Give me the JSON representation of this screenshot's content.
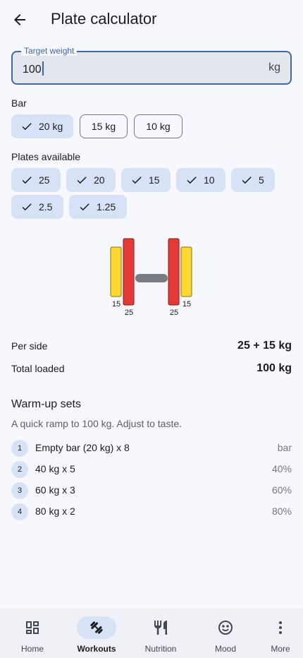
{
  "appbar": {
    "title": "Plate calculator"
  },
  "target": {
    "label": "Target weight",
    "value": "100",
    "suffix": "kg"
  },
  "bar": {
    "label": "Bar",
    "options": [
      {
        "label": "20 kg",
        "selected": true
      },
      {
        "label": "15 kg",
        "selected": false
      },
      {
        "label": "10 kg",
        "selected": false
      }
    ]
  },
  "plates": {
    "label": "Plates available",
    "options": [
      "25",
      "20",
      "15",
      "10",
      "5",
      "2.5",
      "1.25"
    ]
  },
  "visual": {
    "colors": {
      "plate25": "#e53935",
      "plate15": "#fdd835",
      "bar": "#7a7c83"
    },
    "left_outer": "15",
    "left_inner": "25",
    "right_inner": "25",
    "right_outer": "15"
  },
  "summary": {
    "per_side_label": "Per side",
    "per_side_value": "25 + 15 kg",
    "total_label": "Total loaded",
    "total_value": "100 kg"
  },
  "warmup": {
    "title": "Warm-up sets",
    "subtitle": "A quick ramp to 100 kg. Adjust to taste.",
    "items": [
      {
        "num": "1",
        "text": "Empty bar (20 kg) x 8",
        "pct": "bar"
      },
      {
        "num": "2",
        "text": "40 kg x 5",
        "pct": "40%"
      },
      {
        "num": "3",
        "text": "60 kg x 3",
        "pct": "60%"
      },
      {
        "num": "4",
        "text": "80 kg x 2",
        "pct": "80%"
      }
    ]
  },
  "nav": {
    "items": [
      {
        "label": "Home",
        "icon": "dashboard-icon"
      },
      {
        "label": "Workouts",
        "icon": "dumbbell-icon"
      },
      {
        "label": "Nutrition",
        "icon": "restaurant-icon"
      },
      {
        "label": "Mood",
        "icon": "smile-icon"
      },
      {
        "label": "More",
        "icon": "more-vertical-icon"
      }
    ],
    "active": "Workouts"
  },
  "accent": "#3f67a8"
}
